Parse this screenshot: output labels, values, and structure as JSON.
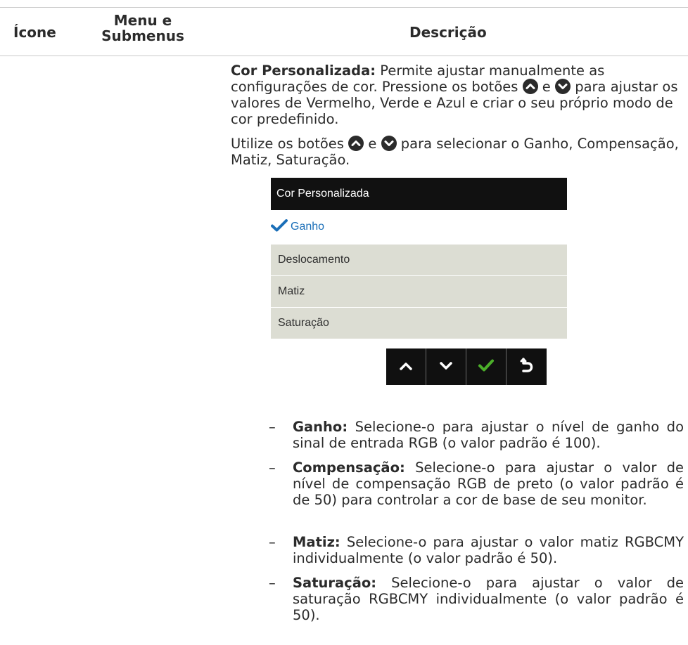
{
  "header": {
    "col_icon": "Ícone",
    "col_menu_line1": "Menu e",
    "col_menu_line2": "Submenus",
    "col_description": "Descrição"
  },
  "paragraph1": {
    "label": "Cor Personalizada:",
    "text_before_buttons": " Permite ajustar manualmente as configurações de cor. Pressione os botões ",
    "conjunction": " e ",
    "text_after_buttons": " para ajustar os valores de Vermelho, Verde e Azul e criar o seu próprio modo de cor predefinido."
  },
  "paragraph2": {
    "text_before_buttons": "Utilize os botões ",
    "conjunction": " e ",
    "text_after_buttons": " para selecionar o Ganho, Compensação, Matiz, Saturação."
  },
  "osd_menu": {
    "title": "Cor Personalizada",
    "items": [
      {
        "label": "Ganho",
        "selected": true
      },
      {
        "label": "Deslocamento",
        "selected": false
      },
      {
        "label": "Matiz",
        "selected": false
      },
      {
        "label": "Saturação",
        "selected": false
      }
    ]
  },
  "osd_buttons": [
    {
      "icon": "chevron-up-icon"
    },
    {
      "icon": "chevron-down-icon"
    },
    {
      "icon": "check-icon"
    },
    {
      "icon": "back-icon"
    }
  ],
  "bullets": [
    {
      "dash": "–",
      "label": "Ganho:",
      "text": " Selecione-o para ajustar o nível de ganho do sinal de entrada RGB (o valor padrão é 100)."
    },
    {
      "dash": "–",
      "label": "Compensação:",
      "text": " Selecione-o para ajustar o valor de nível de compensação RGB de preto (o valor padrão é de 50) para controlar a cor de base de seu monitor."
    },
    {
      "dash": "–",
      "label": "Matiz:",
      "text": " Selecione-o para ajustar o valor matiz RGBCMY individualmente (o valor padrão é 50)."
    },
    {
      "dash": "–",
      "label": "Saturação:",
      "text": " Selecione-o para ajustar o valor de saturação RGBCMY individualmente (o valor padrão é 50)."
    }
  ],
  "colors": {
    "osd_title_bg": "#111111",
    "osd_item_bg": "#dcddd3",
    "osd_selected_text": "#1b6fb8",
    "check_green": "#4caf2a",
    "button_bar_bg": "#101010"
  }
}
